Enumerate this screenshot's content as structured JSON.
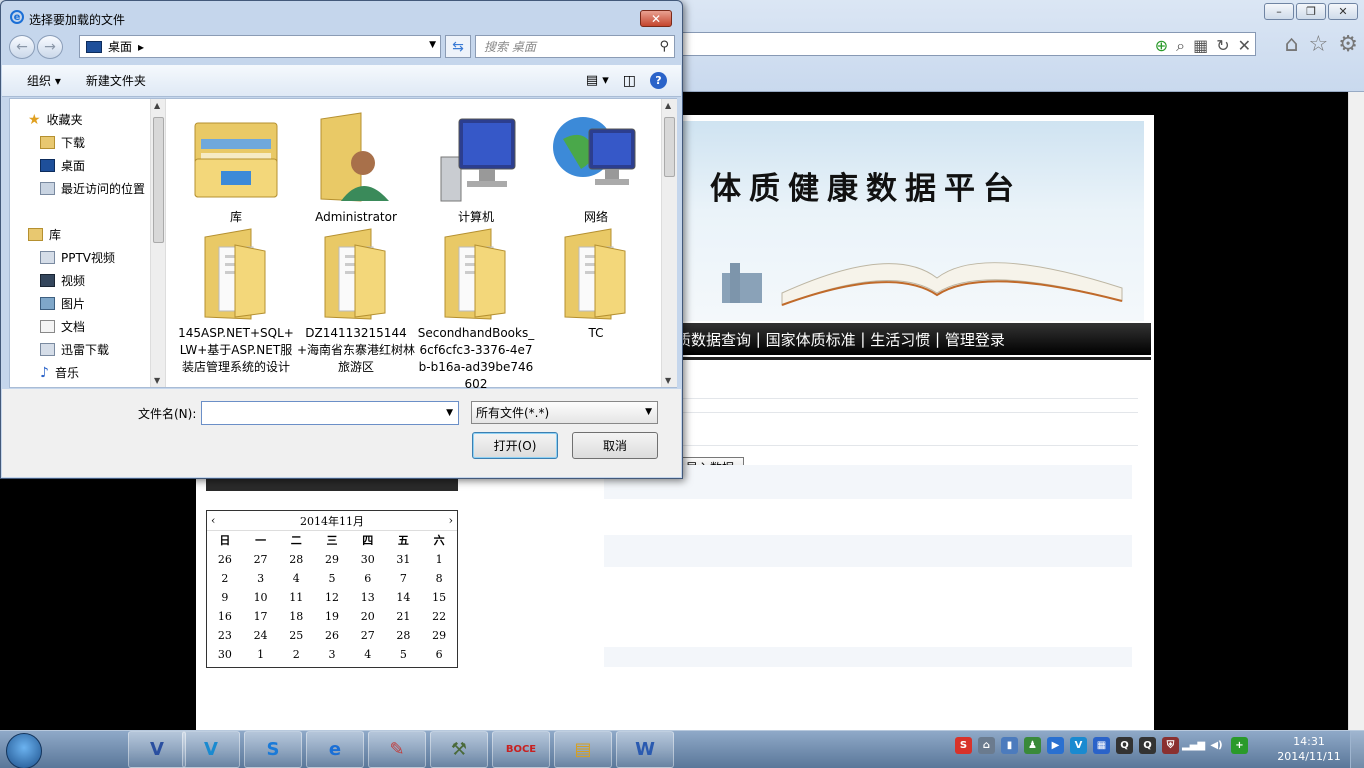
{
  "dialog": {
    "title": "选择要加载的文件",
    "path": "桌面",
    "search_placeholder": "搜索 桌面",
    "toolbar": {
      "organize": "组织 ▾",
      "new_folder": "新建文件夹"
    },
    "sidebar": {
      "favorites": "收藏夹",
      "fav_items": [
        "下载",
        "桌面",
        "最近访问的位置"
      ],
      "libraries": "库",
      "lib_items": [
        "PPTV视频",
        "视频",
        "图片",
        "文档",
        "迅雷下载",
        "音乐"
      ]
    },
    "files": [
      {
        "name": "库",
        "icon": "library-folder-icon"
      },
      {
        "name": "Administrator",
        "icon": "user-folder-icon"
      },
      {
        "name": "计算机",
        "icon": "computer-icon"
      },
      {
        "name": "网络",
        "icon": "network-icon"
      },
      {
        "name": "145ASP.NET+SQL+LW+基于ASP.NET服装店管理系统的设计",
        "icon": "folder-icon"
      },
      {
        "name": "DZ14113215144+海南省东寨港红树林旅游区",
        "icon": "folder-icon"
      },
      {
        "name": "SecondhandBooks_6cf6cfc3-3376-4e7b-b16a-ad39be746602",
        "icon": "folder-icon"
      },
      {
        "name": "TC",
        "icon": "folder-icon"
      }
    ],
    "filename_label": "文件名(N):",
    "filename_value": "",
    "filter_value": "所有文件(*.*)",
    "open_label": "打开(O)",
    "cancel_label": "取消",
    "close_glyph": "✕"
  },
  "page": {
    "banner_title": "体质健康数据平台",
    "nav": [
      "质数据查询",
      "国家体质标准",
      "生活习惯",
      "管理登录"
    ],
    "nav_separator": " | ",
    "import_button": "导入数据",
    "calendar": {
      "header": "2014年11月",
      "prev": "‹",
      "next": "›",
      "weekdays": [
        "日",
        "一",
        "二",
        "三",
        "四",
        "五",
        "六"
      ],
      "days": [
        [
          "26",
          "27",
          "28",
          "29",
          "30",
          "31",
          "1"
        ],
        [
          "2",
          "3",
          "4",
          "5",
          "6",
          "7",
          "8"
        ],
        [
          "9",
          "10",
          "11",
          "12",
          "13",
          "14",
          "15"
        ],
        [
          "16",
          "17",
          "18",
          "19",
          "20",
          "21",
          "22"
        ],
        [
          "23",
          "24",
          "25",
          "26",
          "27",
          "28",
          "29"
        ],
        [
          "30",
          "1",
          "2",
          "3",
          "4",
          "5",
          "6"
        ]
      ]
    }
  },
  "taskbar": {
    "time": "14:31",
    "date": "2014/11/11",
    "apps": [
      "visio-icon",
      "v-app-icon",
      "sogou-icon",
      "ie-icon",
      "paint-icon",
      "tools-icon",
      "boce-icon",
      "explorer-icon",
      "word-icon"
    ],
    "app_glyphs": [
      "V",
      "V",
      "S",
      "e",
      "✎",
      "⚒",
      "BOCE",
      "▤",
      "W"
    ]
  },
  "colors": {
    "accent": "#2a63c9",
    "nav_bg": "#000000",
    "dialog_frame": "#c5d6ec"
  }
}
